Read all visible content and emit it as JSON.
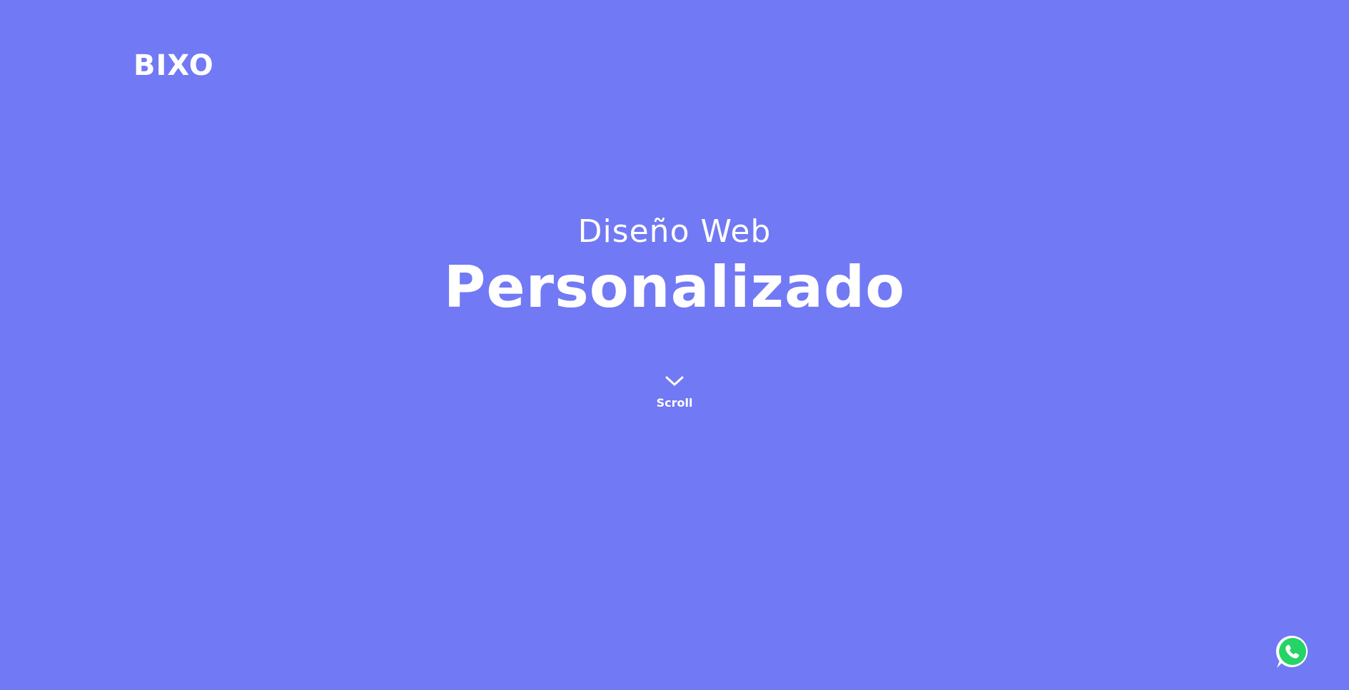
{
  "brand": {
    "logo_text": "BIXO"
  },
  "hero": {
    "subtitle": "Diseño Web",
    "title": "Personalizado"
  },
  "scroll": {
    "label": "Scroll",
    "icon": "chevron-down-icon"
  },
  "whatsapp": {
    "icon": "whatsapp-icon",
    "color": "#25d366"
  },
  "colors": {
    "background": "#7179f4",
    "text": "#ffffff"
  }
}
